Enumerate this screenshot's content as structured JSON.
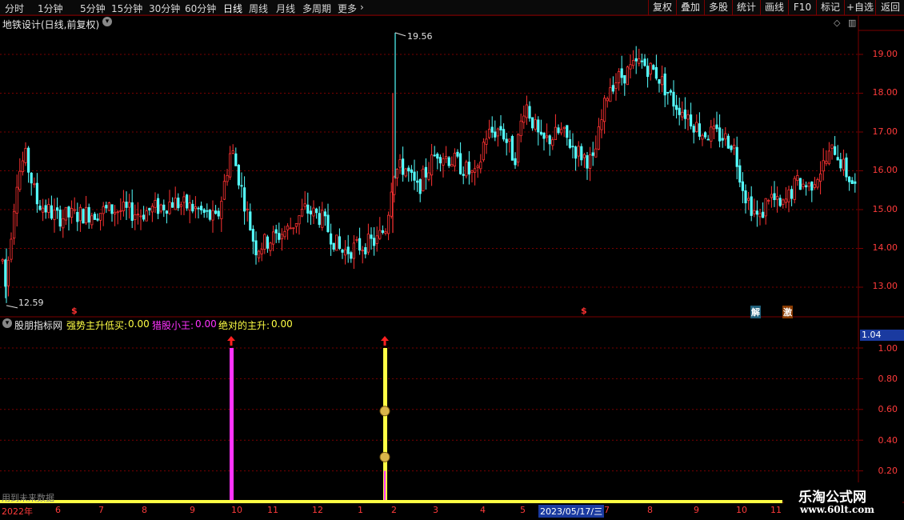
{
  "toolbar": {
    "periods": [
      "分时",
      "1分钟",
      "5分钟",
      "15分钟",
      "30分钟",
      "60分钟",
      "日线",
      "周线",
      "月线",
      "多周期",
      "更多"
    ],
    "active_period": "日线",
    "right_buttons": [
      "复权",
      "叠加",
      "多股",
      "统计",
      "画线",
      "F10",
      "标记",
      "+自选",
      "返回"
    ]
  },
  "main_chart": {
    "title": "地铁设计(日线,前复权)",
    "price_labels": [
      "19.00",
      "18.00",
      "17.00",
      "16.00",
      "15.00",
      "14.00",
      "13.00"
    ],
    "high_label": "19.56",
    "low_label": "12.59",
    "tags": [
      {
        "text": "解",
        "bg": "#1f5f7a",
        "color": "#ffffff"
      },
      {
        "text": "激",
        "bg": "#8a3b00",
        "color": "#ffffff"
      }
    ],
    "signal_marks": [
      "$",
      "$"
    ]
  },
  "indicator": {
    "name": "股朋指标网",
    "items": [
      {
        "label": "强势主升低买:",
        "value": "0.00",
        "color": "#ffff44"
      },
      {
        "label": "猎股小王:",
        "value": "0.00",
        "color": "#ff33ff"
      },
      {
        "label": "绝对的主升:",
        "value": "0.00",
        "color": "#ffff44"
      }
    ],
    "value_box": "1.04",
    "axis_labels": [
      "1.00",
      "0.80",
      "0.60",
      "0.40",
      "0.20"
    ],
    "future_note": "用到未来数据"
  },
  "date_axis": {
    "labels": [
      "2022年",
      "6",
      "7",
      "8",
      "9",
      "10",
      "11",
      "12",
      "1",
      "2",
      "3",
      "4",
      "5",
      "2023/05/17/三",
      "7",
      "8",
      "9",
      "10",
      "11"
    ]
  },
  "watermark": {
    "line1": "乐淘公式网",
    "line2": "www.60lt.com"
  },
  "colors": {
    "up": "#ff3232",
    "down": "#54ffff",
    "grid": "#7a0000",
    "magenta": "#ff33ff",
    "yellow": "#ffff44"
  }
}
